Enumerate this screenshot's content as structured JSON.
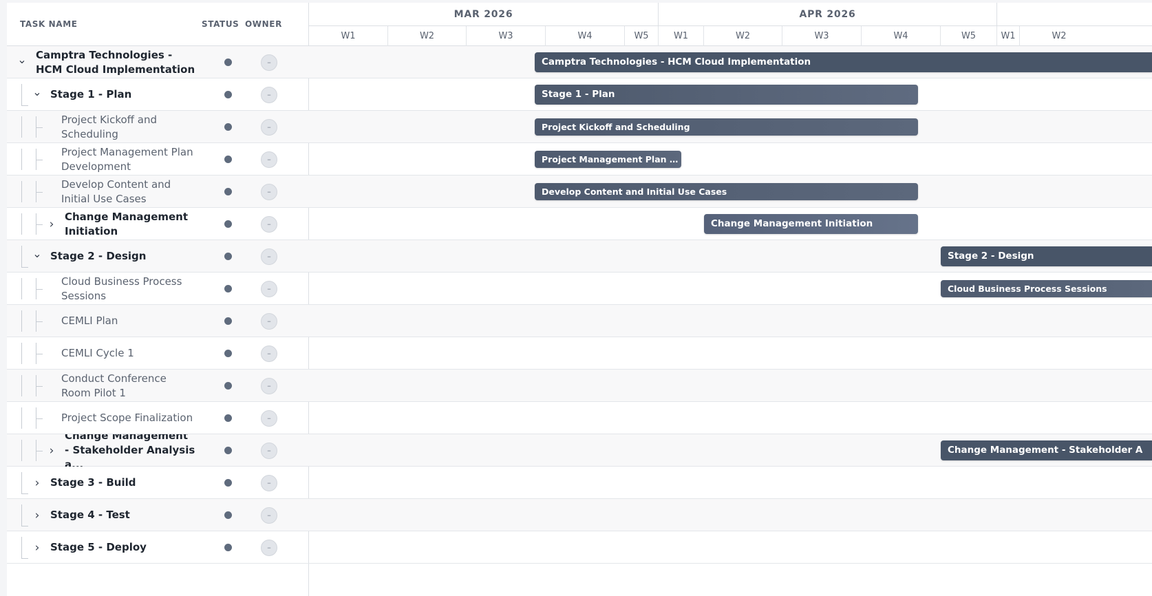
{
  "columns": {
    "task_name": "TASK NAME",
    "status": "STATUS",
    "owner": "OWNER"
  },
  "timeline": {
    "months": [
      "MAR 2026",
      "APR 2026"
    ],
    "weeks": [
      "W1",
      "W2",
      "W3",
      "W4",
      "W5",
      "W1",
      "W2",
      "W3",
      "W4",
      "W5",
      "W1",
      "W2"
    ]
  },
  "owner_placeholder": "–",
  "colors": {
    "status_dot": "#5f6b7d",
    "bar_dark": "#485568",
    "bar_mid": "#56627a"
  },
  "tasks": [
    {
      "name": "Camptra Technologies - HCM Cloud Implementation",
      "level": 0,
      "expander": "expanded",
      "bar_label": "Camptra Technologies - HCM Cloud Implementation"
    },
    {
      "name": "Stage 1 - Plan",
      "level": 1,
      "expander": "expanded",
      "bar_label": "Stage 1 - Plan"
    },
    {
      "name": "Project Kickoff and Scheduling",
      "level": 2,
      "expander": "none",
      "bar_label": "Project Kickoff and Scheduling"
    },
    {
      "name": "Project Management Plan Development",
      "level": 2,
      "expander": "none",
      "bar_label": "Project Management Plan Develo..."
    },
    {
      "name": "Develop Content and Initial Use Cases",
      "level": 2,
      "expander": "none",
      "bar_label": "Develop Content and Initial Use Cases"
    },
    {
      "name": "Change Management Initiation",
      "level": 2,
      "expander": "collapsed",
      "bar_label": "Change Management Initiation"
    },
    {
      "name": "Stage 2 - Design",
      "level": 1,
      "expander": "expanded",
      "bar_label": "Stage 2 - Design"
    },
    {
      "name": "Cloud Business Process Sessions",
      "level": 2,
      "expander": "none",
      "bar_label": "Cloud Business Process Sessions"
    },
    {
      "name": "CEMLI Plan",
      "level": 2,
      "expander": "none",
      "bar_label": ""
    },
    {
      "name": "CEMLI Cycle 1",
      "level": 2,
      "expander": "none",
      "bar_label": ""
    },
    {
      "name": "Conduct Conference Room Pilot 1",
      "level": 2,
      "expander": "none",
      "bar_label": ""
    },
    {
      "name": "Project Scope Finalization",
      "level": 2,
      "expander": "none",
      "bar_label": ""
    },
    {
      "name": "Change Management - Stakeholder Analysis a...",
      "level": 2,
      "expander": "collapsed",
      "bar_label": "Change Management - Stakeholder A"
    },
    {
      "name": "Stage 3 - Build",
      "level": 1,
      "expander": "collapsed",
      "bar_label": ""
    },
    {
      "name": "Stage 4 - Test",
      "level": 1,
      "expander": "collapsed",
      "bar_label": ""
    },
    {
      "name": "Stage 5 - Deploy",
      "level": 1,
      "expander": "collapsed",
      "bar_label": ""
    }
  ]
}
